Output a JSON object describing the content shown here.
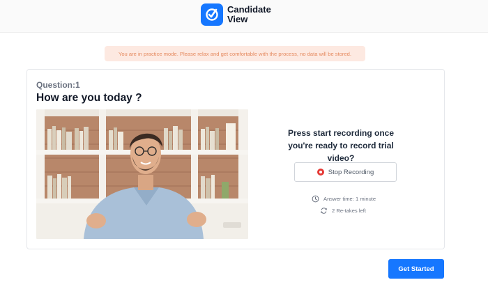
{
  "brand": {
    "name_line1": "Candidate",
    "name_line2": "View",
    "accent": "#1677ff"
  },
  "banner": {
    "text": "You are in practice mode. Please relax and get comfortable with the process, no data will be stored.",
    "text_color": "#e58a5f",
    "bg_color": "#fde9e1"
  },
  "question": {
    "label": "Question:1",
    "title": "How are you today ?"
  },
  "recording": {
    "prompt": "Press start recording once you're ready to record trial video?",
    "stop_label": "Stop Recording",
    "answer_time": "Answer time: 1 minute",
    "retakes": "2 Re-takes left",
    "rec_color": "#e53935"
  },
  "icons": {
    "logo": "check-circle-icon",
    "clock": "clock-icon",
    "retake": "retake-icon",
    "record": "record-dot-icon"
  },
  "actions": {
    "get_started_label": "Get Started"
  }
}
